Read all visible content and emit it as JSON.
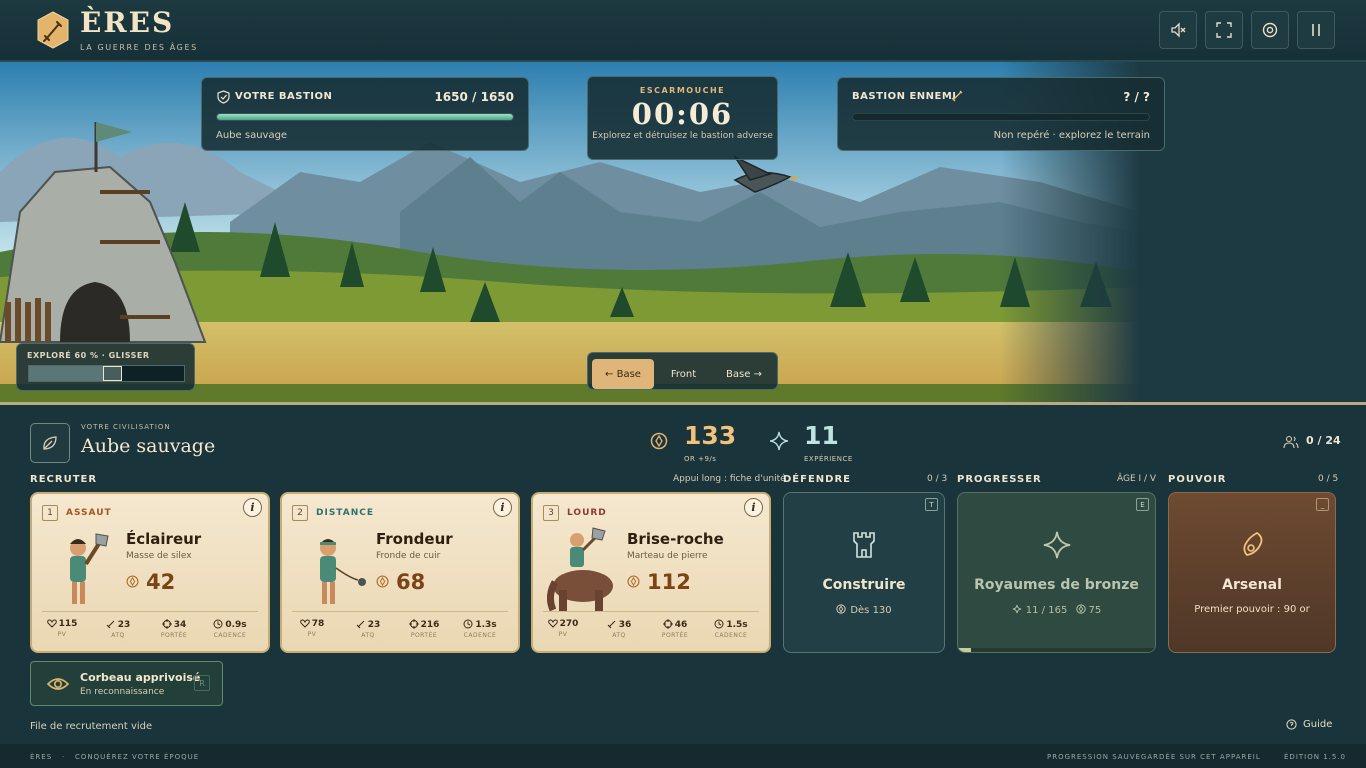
{
  "app": {
    "title": "ÈRES",
    "subtitle": "LA GUERRE DES ÂGES"
  },
  "top_controls": [
    {
      "name": "mute-icon"
    },
    {
      "name": "fullscreen-icon"
    },
    {
      "name": "settings-icon"
    },
    {
      "name": "pause-icon"
    }
  ],
  "hud": {
    "player_bastion": {
      "label": "VOTRE BASTION",
      "hp": "1650 / 1650",
      "hp_fraction": 1.0,
      "age": "Aube sauvage"
    },
    "mode": {
      "label": "ESCARMOUCHE",
      "timer": "00:06",
      "objective": "Explorez et détruisez le bastion adverse"
    },
    "enemy_bastion": {
      "label": "BASTION ENNEMI",
      "hp": "? / ?",
      "status": "Non repéré · explorez le terrain"
    },
    "explore": {
      "label": "EXPLORÉ 60 % · GLISSER",
      "fraction": 0.6
    },
    "camera_nav": [
      {
        "label": "← Base",
        "active": true
      },
      {
        "label": "Front",
        "active": false
      },
      {
        "label": "Base →",
        "active": false
      }
    ]
  },
  "civ": {
    "label": "VOTRE CIVILISATION",
    "name": "Aube sauvage"
  },
  "resources": {
    "gold": {
      "value": "133",
      "label": "OR +9/s",
      "color": "#f1c27a"
    },
    "xp": {
      "value": "11",
      "label": "EXPÉRIENCE",
      "color": "#bfe3e0"
    },
    "population": "0 / 24"
  },
  "recruit": {
    "title": "RECRUTER",
    "hint": "Appui long : fiche d'unité",
    "units": [
      {
        "key": "1",
        "class": "ASSAUT",
        "class_color": "#a4561c",
        "name": "Éclaireur",
        "weapon": "Masse de silex",
        "cost": "42",
        "stats": {
          "hp": "115",
          "atk": "23",
          "range": "34",
          "rate": "0.9s"
        }
      },
      {
        "key": "2",
        "class": "DISTANCE",
        "class_color": "#2f6f73",
        "name": "Frondeur",
        "weapon": "Fronde de cuir",
        "cost": "68",
        "stats": {
          "hp": "78",
          "atk": "23",
          "range": "216",
          "rate": "1.3s"
        }
      },
      {
        "key": "3",
        "class": "LOURD",
        "class_color": "#8b3a3a",
        "name": "Brise-roche",
        "weapon": "Marteau de pierre",
        "cost": "112",
        "stats": {
          "hp": "270",
          "atk": "36",
          "range": "46",
          "rate": "1.5s"
        }
      }
    ],
    "stat_labels": {
      "hp": "PV",
      "atk": "ATQ",
      "range": "PORTÉE",
      "rate": "CADENCE"
    }
  },
  "defend": {
    "title": "DÉFENDRE",
    "count": "0 / 3",
    "key": "T",
    "action": "Construire",
    "cost": "Dès 130"
  },
  "progress": {
    "title": "PROGRESSER",
    "age": "ÂGE I / V",
    "key": "E",
    "action": "Royaumes de bronze",
    "xp": "11 / 165",
    "gold": "75",
    "fraction": 0.067
  },
  "power": {
    "title": "POUVOIR",
    "count": "0 / 5",
    "key": "_",
    "action": "Arsenal",
    "detail": "Premier pouvoir : 90 or"
  },
  "scout": {
    "name": "Corbeau apprivoisé",
    "status": "En reconnaissance",
    "key": "R"
  },
  "queue": {
    "status": "File de recrutement vide"
  },
  "guide": {
    "label": "Guide"
  },
  "footer": {
    "left_a": "ÈRES",
    "left_b": "CONQUÉREZ VOTRE ÉPOQUE",
    "right_a": "PROGRESSION SAUVEGARDÉE SUR CET APPAREIL",
    "right_b": "ÉDITION 1.5.0"
  }
}
